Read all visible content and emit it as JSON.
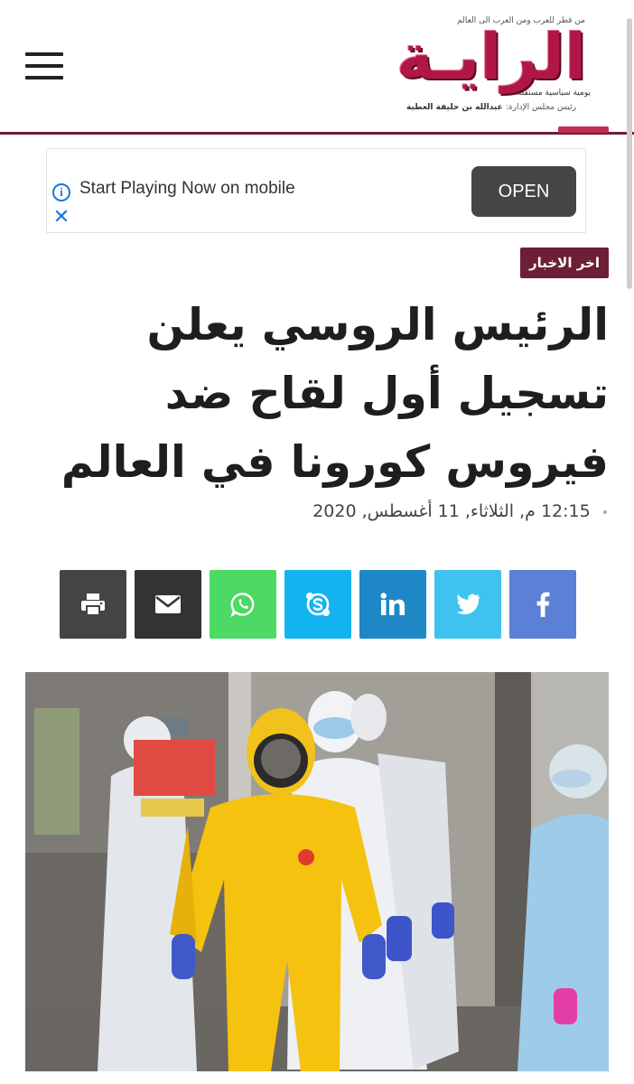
{
  "header": {
    "logo_text": "الرايـة",
    "logo_tagline": "من قطر للعرب ومن العرب الى العالم",
    "logo_subtitle": "يومية سياسية مستقلة",
    "chairman_label": "رئيس مجلس الإدارة:",
    "chairman_name": "عبدالله بن خليفة العطية",
    "brand_color": "#b11746",
    "accent_color": "#6d1f35"
  },
  "ad": {
    "text": "Start Playing Now on mobile",
    "button_label": "OPEN"
  },
  "article": {
    "category": "اخر الاخبار",
    "headline": "الرئيس الروسي يعلن تسجيل أول لقاح ضد فيروس كورونا في العالم",
    "timestamp": "12:15 م, الثلاثاء, 11 أغسطس, 2020"
  },
  "share": [
    {
      "icon": "print-icon",
      "color": "#444444"
    },
    {
      "icon": "email-icon",
      "color": "#333333"
    },
    {
      "icon": "whatsapp-icon",
      "color": "#4cd964"
    },
    {
      "icon": "skype-icon",
      "color": "#13b3f0"
    },
    {
      "icon": "linkedin-icon",
      "color": "#1e88c7"
    },
    {
      "icon": "twitter-icon",
      "color": "#3fc2f0"
    },
    {
      "icon": "facebook-icon",
      "color": "#5b80d6"
    }
  ]
}
